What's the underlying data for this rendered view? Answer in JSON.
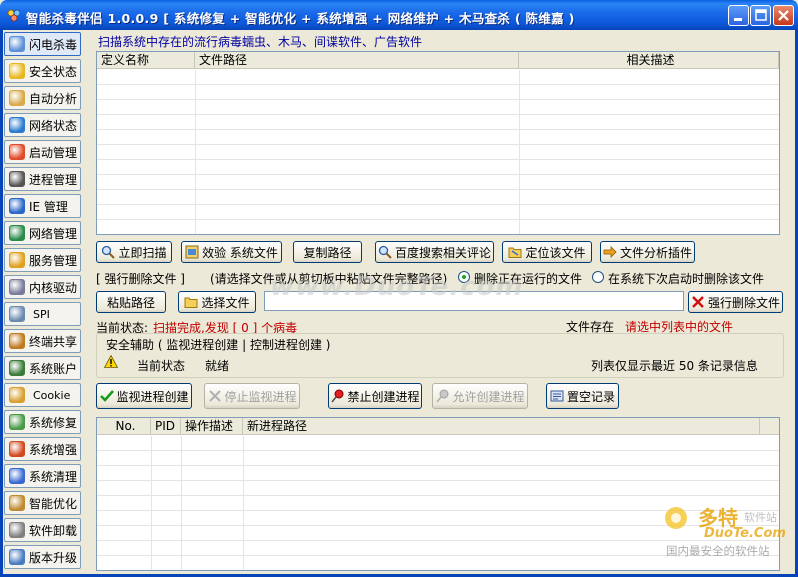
{
  "window": {
    "title": "智能杀毒伴侣 1.0.0.9 [ 系统修复 + 智能优化 + 系统增强 + 网络维护 + 木马查杀 ( 陈维嘉 )"
  },
  "sidebar": {
    "items": [
      {
        "label": "闪电杀毒",
        "icon": "magnifier-icon",
        "color": "#5b8fd6"
      },
      {
        "label": "安全状态",
        "icon": "shield-icon",
        "color": "#e8b820"
      },
      {
        "label": "自动分析",
        "icon": "folder-pen-icon",
        "color": "#d9a94a"
      },
      {
        "label": "网络状态",
        "icon": "globe-icon",
        "color": "#2a7ad0"
      },
      {
        "label": "启动管理",
        "icon": "windows-flag-icon",
        "color": "#e04a2a"
      },
      {
        "label": "进程管理",
        "icon": "monitor-icon",
        "color": "#555555"
      },
      {
        "label": "IE 管理",
        "icon": "ie-icon",
        "color": "#2a66c8"
      },
      {
        "label": "网络管理",
        "icon": "network-globe-icon",
        "color": "#2a8a4a"
      },
      {
        "label": "服务管理",
        "icon": "service-gear-icon",
        "color": "#e0a020"
      },
      {
        "label": "内核驱动",
        "icon": "driver-icon",
        "color": "#7a7a9a"
      },
      {
        "label": "SPI",
        "icon": "spi-icon",
        "color": "#6a8ab0"
      },
      {
        "label": "终端共享",
        "icon": "share-icon",
        "color": "#c07a20"
      },
      {
        "label": "系统账户",
        "icon": "user-icon",
        "color": "#3a7a3a"
      },
      {
        "label": "Cookie",
        "icon": "cookie-icon",
        "color": "#d8a030"
      },
      {
        "label": "系统修复",
        "icon": "repair-icon",
        "color": "#4a9a4a"
      },
      {
        "label": "系统增强",
        "icon": "enhance-flag-icon",
        "color": "#d04a20"
      },
      {
        "label": "系统清理",
        "icon": "cleanup-icon",
        "color": "#3a6ad0"
      },
      {
        "label": "智能优化",
        "icon": "optimize-icon",
        "color": "#c08a30"
      },
      {
        "label": "软件卸载",
        "icon": "uninstall-icon",
        "color": "#808080"
      },
      {
        "label": "版本升级",
        "icon": "upgrade-icon",
        "color": "#4a7ac0"
      }
    ]
  },
  "scan": {
    "hint": "扫描系统中存在的流行病毒蠕虫、木马、间谍软件、广告软件",
    "columns": [
      "定义名称",
      "文件路径",
      "相关描述"
    ]
  },
  "actions": {
    "buttons": [
      "立即扫描",
      "效验 系统文件",
      "复制路径",
      "百度搜索相关评论",
      "定位该文件",
      "文件分析插件"
    ]
  },
  "force_delete": {
    "label": "[ 强行删除文件 ]",
    "instruction": "(请选择文件或从剪切板中粘贴文件完整路径)",
    "option_now": "删除正在运行的文件",
    "option_boot": "在系统下次启动时删除该文件",
    "paste_button": "粘贴路径",
    "choose_button": "选择文件",
    "delete_button": "强行删除文件"
  },
  "status": {
    "label": "当前状态:",
    "value": "扫描完成,发现 [ 0 ] 个病毒",
    "file_exists_label": "文件存在",
    "file_exists_value": "请选中列表中的文件"
  },
  "guard": {
    "title": "安全辅助 ( 监视进程创建 | 控制进程创建 )",
    "state_label": "当前状态",
    "state_value": "就绪",
    "note": "列表仅显示最近 50 条记录信息"
  },
  "process_buttons": [
    "监视进程创建",
    "停止监视进程",
    "禁止创建进程",
    "允许创建进程",
    "置空记录"
  ],
  "process_table": {
    "columns": [
      "No.",
      "PID",
      "操作描述",
      "新进程路径"
    ]
  },
  "watermark": {
    "main": "www.DuoTe.com",
    "brand": "多特",
    "brand_sub": "软件站",
    "site": "DuoTe.Com",
    "slogan": "国内最安全的软件站"
  }
}
